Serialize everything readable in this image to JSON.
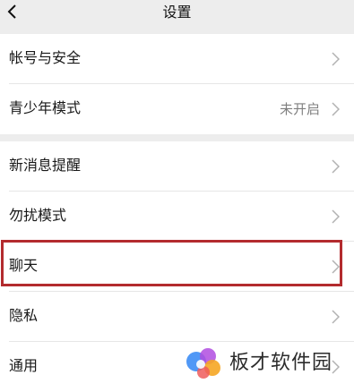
{
  "header": {
    "title": "设置"
  },
  "groups": [
    {
      "items": [
        {
          "label": "帐号与安全",
          "value": ""
        },
        {
          "label": "青少年模式",
          "value": "未开启"
        }
      ]
    },
    {
      "items": [
        {
          "label": "新消息提醒",
          "value": ""
        },
        {
          "label": "勿扰模式",
          "value": ""
        },
        {
          "label": "聊天",
          "value": ""
        },
        {
          "label": "隐私",
          "value": ""
        },
        {
          "label": "通用",
          "value": ""
        }
      ]
    }
  ],
  "highlight": {
    "color": "#b32b2e",
    "target": "聊天"
  },
  "watermark": {
    "text": "板才软件园",
    "icon": "colorful-dots-logo"
  },
  "colors": {
    "page_background": "#ededed",
    "cell_background": "#ffffff",
    "text": "#191919",
    "secondary_text": "#7f7f7f"
  }
}
